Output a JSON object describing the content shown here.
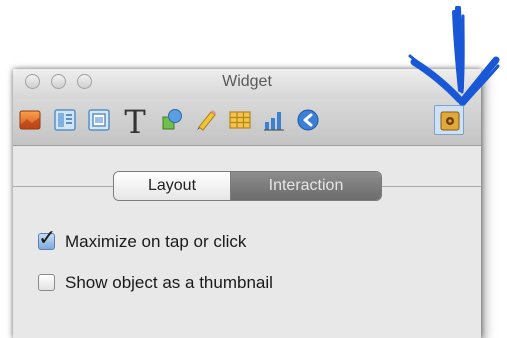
{
  "window": {
    "title": "Widget"
  },
  "toolbar": {
    "tools": [
      {
        "icon": "media-icon"
      },
      {
        "icon": "sidebar-icon"
      },
      {
        "icon": "frame-icon"
      },
      {
        "icon": "text-icon",
        "glyph": "T"
      },
      {
        "icon": "shapes-icon"
      },
      {
        "icon": "pencil-icon"
      },
      {
        "icon": "table-icon"
      },
      {
        "icon": "chart-icon"
      },
      {
        "icon": "navigation-icon"
      },
      {
        "icon": "widget-settings-icon",
        "active": true
      }
    ]
  },
  "tabs": {
    "layout_label": "Layout",
    "interaction_label": "Interaction",
    "selected": "Interaction"
  },
  "options": {
    "maximize": {
      "label": "Maximize on tap or click",
      "checked": true
    },
    "thumbnail": {
      "label": "Show object as a thumbnail",
      "checked": false
    }
  },
  "colors": {
    "annotation_arrow": "#1a57d6",
    "active_tab": "#7c7c7c"
  }
}
